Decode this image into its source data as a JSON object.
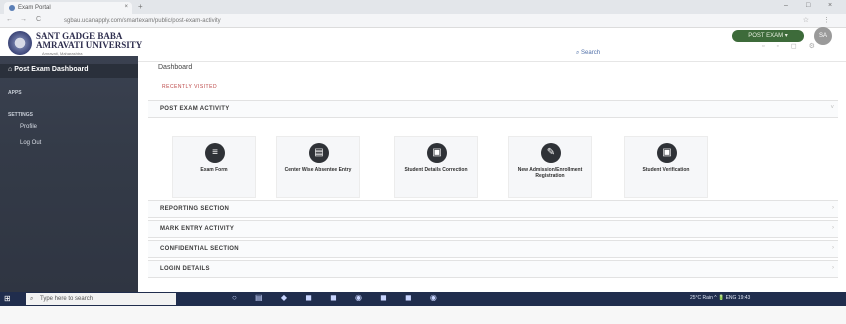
{
  "browser": {
    "tab_title": "Exam Portal",
    "tab_close": "×",
    "new_tab": "+",
    "window_controls": [
      "–",
      "□",
      "×"
    ],
    "nav": [
      "←",
      "→",
      "C"
    ],
    "url": "sgbau.ucanapply.com/smartexam/public/post-exam-activity",
    "addr_icons": "☆ ⋮"
  },
  "header": {
    "university_name_line1": "SANT GADGE BABA",
    "university_name_line2": "AMRAVATI UNIVERSITY",
    "university_sub": "Amravati, Maharashtra",
    "search_label": "Search",
    "header_icons": "▫ ◦ ◻ ⚙",
    "role_button": "POST EXAM ▾",
    "avatar_initials": "SA"
  },
  "sidebar": {
    "active_item": "Post Exam Dashboard",
    "heading_apps": "APPS",
    "heading_settings": "SETTINGS",
    "items": [
      "Profile",
      "Log Out"
    ]
  },
  "main": {
    "breadcrumb": "Dashboard",
    "recent_label": "RECENTLY VISITED",
    "sections": [
      "POST EXAM ACTIVITY",
      "REPORTING SECTION",
      "MARK ENTRY ACTIVITY",
      "CONFIDENTIAL SECTION",
      "LOGIN DETAILS"
    ],
    "chevron_down": "˅",
    "chevron_right": "›",
    "cards": [
      {
        "label": "Exam Form",
        "icon": "form-icon",
        "glyph": "≡"
      },
      {
        "label": "Center Wise Absentee Entry",
        "icon": "absentee-icon",
        "glyph": "▤"
      },
      {
        "label": "Student Details Correction",
        "icon": "id-card-icon",
        "glyph": "▣"
      },
      {
        "label": "New Admission/Enrollment Registration",
        "icon": "clipboard-icon",
        "glyph": "✎"
      },
      {
        "label": "Student Verification",
        "icon": "verification-icon",
        "glyph": "▣"
      }
    ]
  },
  "taskbar": {
    "start": "⊞",
    "search_placeholder": "Type here to search",
    "search_icon": "⌕",
    "apps": "○ ▤ ◆ ◼ ◼ ◉ ◼ ◼ ◉",
    "tray": "25°C Rain  ^ 🔋 ENG 19:43"
  },
  "colors": {
    "sidebar_bg": "#343b48",
    "role_button_bg": "#3d6b3a",
    "taskbar_bg": "#202d4d",
    "card_icon_bg": "#2f3237"
  }
}
